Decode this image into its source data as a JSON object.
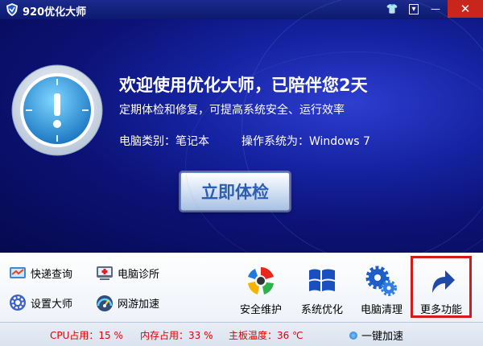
{
  "titlebar": {
    "title": "920优化大师",
    "skin_glyph": "👕",
    "menu_glyph": "▾",
    "minimize_glyph": "—",
    "close_glyph": "✕"
  },
  "hero": {
    "headline": "欢迎使用优化大师，已陪伴您2天",
    "subline": "定期体检和修复，可提高系统安全、运行效率",
    "pc_type": "电脑类别：笔记本",
    "os": "操作系统为：Windows 7",
    "scan_button": "立即体检"
  },
  "tools": {
    "mini": [
      {
        "label": "快递查询",
        "icon": "express-icon"
      },
      {
        "label": "电脑诊所",
        "icon": "clinic-icon"
      },
      {
        "label": "设置大师",
        "icon": "settings-icon"
      },
      {
        "label": "网游加速",
        "icon": "game-speed-icon"
      }
    ],
    "big": [
      {
        "label": "安全维护",
        "icon": "security-icon"
      },
      {
        "label": "系统优化",
        "icon": "windows-icon"
      },
      {
        "label": "电脑清理",
        "icon": "gears-icon"
      },
      {
        "label": "更多功能",
        "icon": "arrow-icon"
      }
    ]
  },
  "status": {
    "cpu": "CPU占用：15 %",
    "mem": "内存占用：33 %",
    "temp": "主板温度：36 ℃",
    "boost": "一键加速"
  },
  "colors": {
    "accent": "#1624a4",
    "status_text": "#e00000",
    "highlight": "#d31b1b"
  }
}
